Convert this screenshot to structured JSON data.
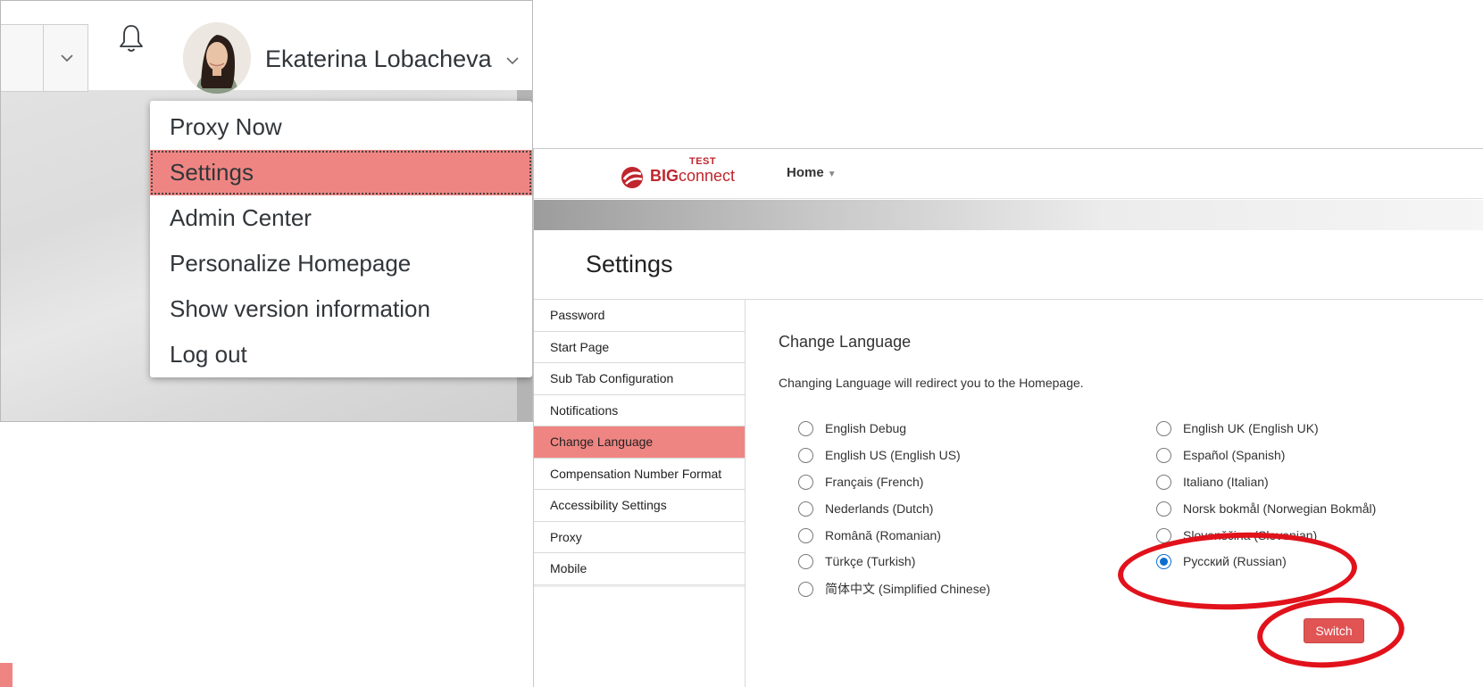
{
  "user_header": {
    "user_name": "Ekaterina Lobacheva"
  },
  "user_menu": {
    "items": [
      {
        "label": "Proxy Now"
      },
      {
        "label": "Settings"
      },
      {
        "label": "Admin Center"
      },
      {
        "label": "Personalize Homepage"
      },
      {
        "label": "Show version information"
      },
      {
        "label": "Log out"
      }
    ],
    "active_item": "Settings"
  },
  "app_header": {
    "logo_badge": "TEST",
    "logo_text_bold": "BIG",
    "logo_text_rest": "connect",
    "home_label": "Home",
    "home_caret": "▼"
  },
  "settings": {
    "title": "Settings",
    "nav": [
      {
        "label": "Password"
      },
      {
        "label": "Start Page"
      },
      {
        "label": "Sub Tab Configuration"
      },
      {
        "label": "Notifications"
      },
      {
        "label": "Change Language"
      },
      {
        "label": "Compensation Number Format"
      },
      {
        "label": "Accessibility Settings"
      },
      {
        "label": "Proxy"
      },
      {
        "label": "Mobile"
      }
    ],
    "active_nav": "Change Language",
    "change_language": {
      "title": "Change Language",
      "description": "Changing Language will redirect you to the Homepage.",
      "languages_left": [
        {
          "label": "English Debug",
          "checked": false
        },
        {
          "label": "English US (English US)",
          "checked": false
        },
        {
          "label": "Français (French)",
          "checked": false
        },
        {
          "label": "Nederlands (Dutch)",
          "checked": false
        },
        {
          "label": "Română (Romanian)",
          "checked": false
        },
        {
          "label": "Türkçe (Turkish)",
          "checked": false
        },
        {
          "label": "简体中文 (Simplified Chinese)",
          "checked": false
        }
      ],
      "languages_right": [
        {
          "label": "English UK (English UK)",
          "checked": false
        },
        {
          "label": "Español (Spanish)",
          "checked": false
        },
        {
          "label": "Italiano (Italian)",
          "checked": false
        },
        {
          "label": "Norsk bokmål (Norwegian Bokmål)",
          "checked": false
        },
        {
          "label": "Slovenščina (Slovenian)",
          "checked": false
        },
        {
          "label": "Русский (Russian)",
          "checked": true
        }
      ],
      "switch_label": "Switch"
    }
  },
  "colors": {
    "highlight": "#ef8582",
    "radio_checked": "#0a6ed1",
    "switch_button": "#e05454",
    "annotation": "#e1121b"
  }
}
